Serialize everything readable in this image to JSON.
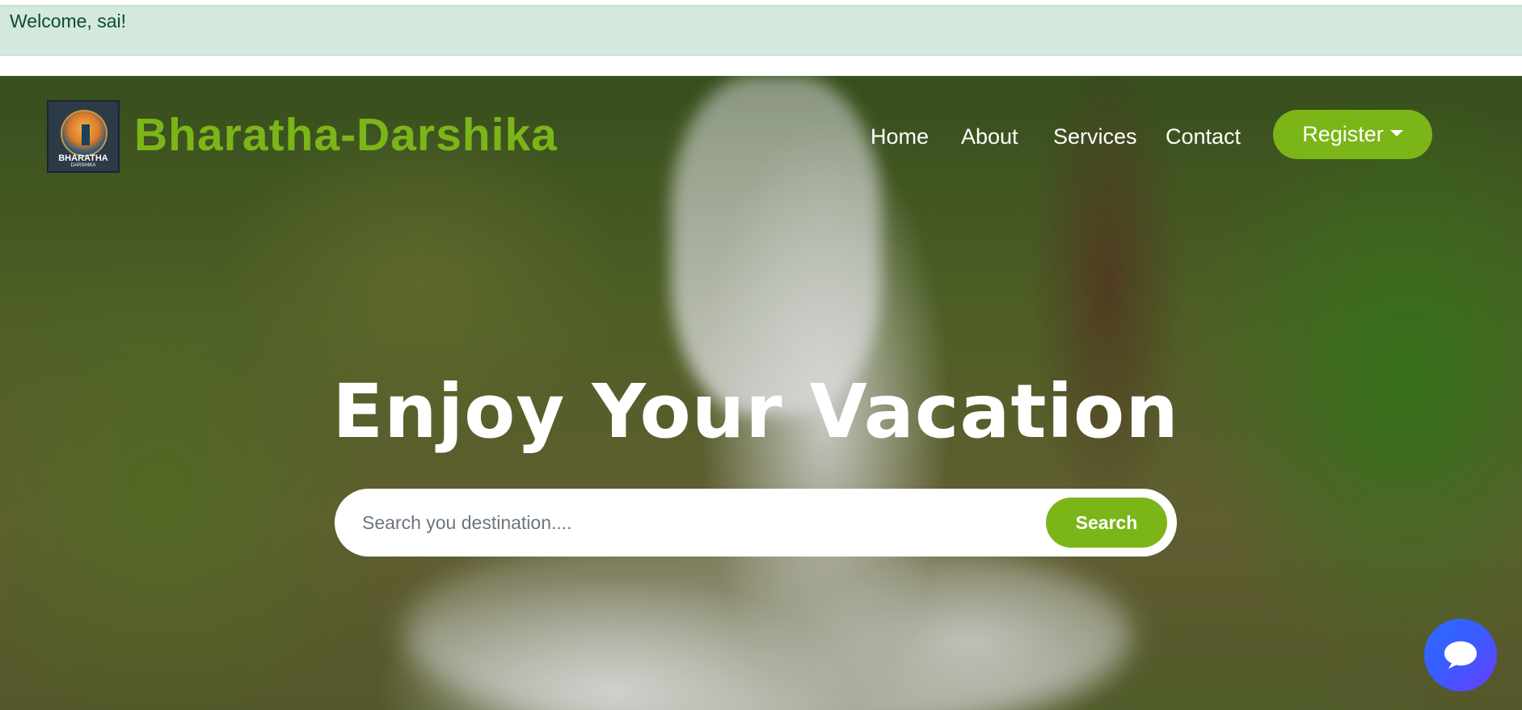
{
  "welcome": {
    "text": "Welcome, sai!"
  },
  "navbar": {
    "logo_text": "BHARATHA",
    "logo_sub": "DARSHIKA",
    "brand": "Bharatha-Darshika",
    "links": [
      "Home",
      "About",
      "Services",
      "Contact"
    ],
    "register_label": "Register"
  },
  "hero": {
    "headline": "Enjoy Your Vacation",
    "search_placeholder": "Search you destination....",
    "search_button": "Search"
  },
  "colors": {
    "accent": "#7cb518",
    "welcome_bg": "#d3e9de",
    "chat_bubble": "#3b5bff"
  },
  "icons": {
    "chat": "chat-bubble-icon"
  }
}
